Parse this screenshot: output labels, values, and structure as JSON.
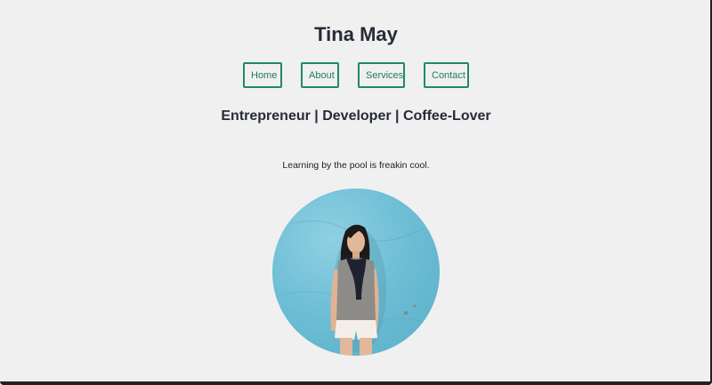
{
  "site": {
    "title": "Tina May",
    "tagline": "Entrepreneur | Developer | Coffee-Lover"
  },
  "nav": {
    "items": [
      {
        "label": "Home"
      },
      {
        "label": "About"
      },
      {
        "label": "Services"
      },
      {
        "label": "Contact"
      }
    ]
  },
  "main": {
    "caption": "Learning by the pool is freakin cool."
  },
  "colors": {
    "background": "#f0f0f0",
    "accent": "#1f8a66",
    "text": "#262b36",
    "photo_wall": "#6fbfd6"
  }
}
